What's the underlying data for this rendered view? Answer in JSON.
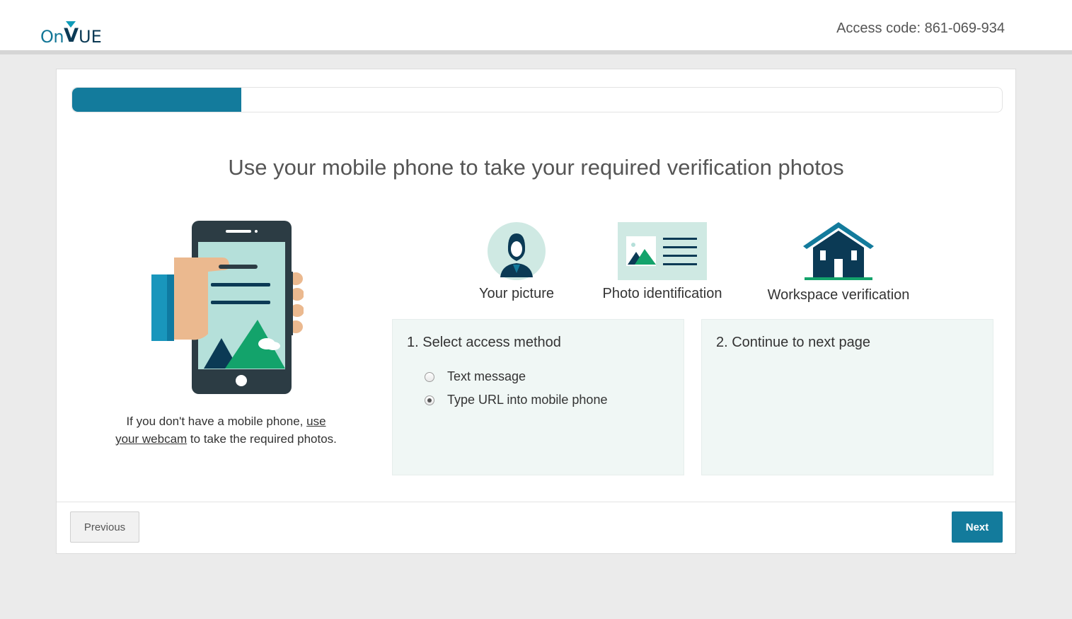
{
  "header": {
    "logo_on": "On",
    "logo_v": "V",
    "logo_ue": "UE",
    "access_code": "Access code: 861-069-934"
  },
  "progress": {
    "fraction": 0.182
  },
  "main": {
    "headline": "Use your mobile phone to take your required verification photos",
    "webcam_note_pre": "If you don't have a mobile phone, ",
    "webcam_link": "use your webcam",
    "webcam_note_post": " to take the required photos.",
    "photo_types": [
      {
        "label": "Your picture",
        "icon": "person-portrait-icon"
      },
      {
        "label": "Photo identification",
        "icon": "id-card-icon"
      },
      {
        "label": "Workspace verification",
        "icon": "house-icon"
      }
    ],
    "step1": {
      "title": "1. Select access method",
      "options": [
        {
          "label": "Text message",
          "checked": false
        },
        {
          "label": "Type URL into mobile phone",
          "checked": true
        }
      ]
    },
    "step2": {
      "title": "2. Continue to next page"
    }
  },
  "footer": {
    "previous_label": "Previous",
    "next_label": "Next"
  },
  "colors": {
    "accent": "#137b9c",
    "dark_navy": "#0b3a55",
    "green": "#13a36b",
    "panel_bg": "#f0f7f5"
  }
}
